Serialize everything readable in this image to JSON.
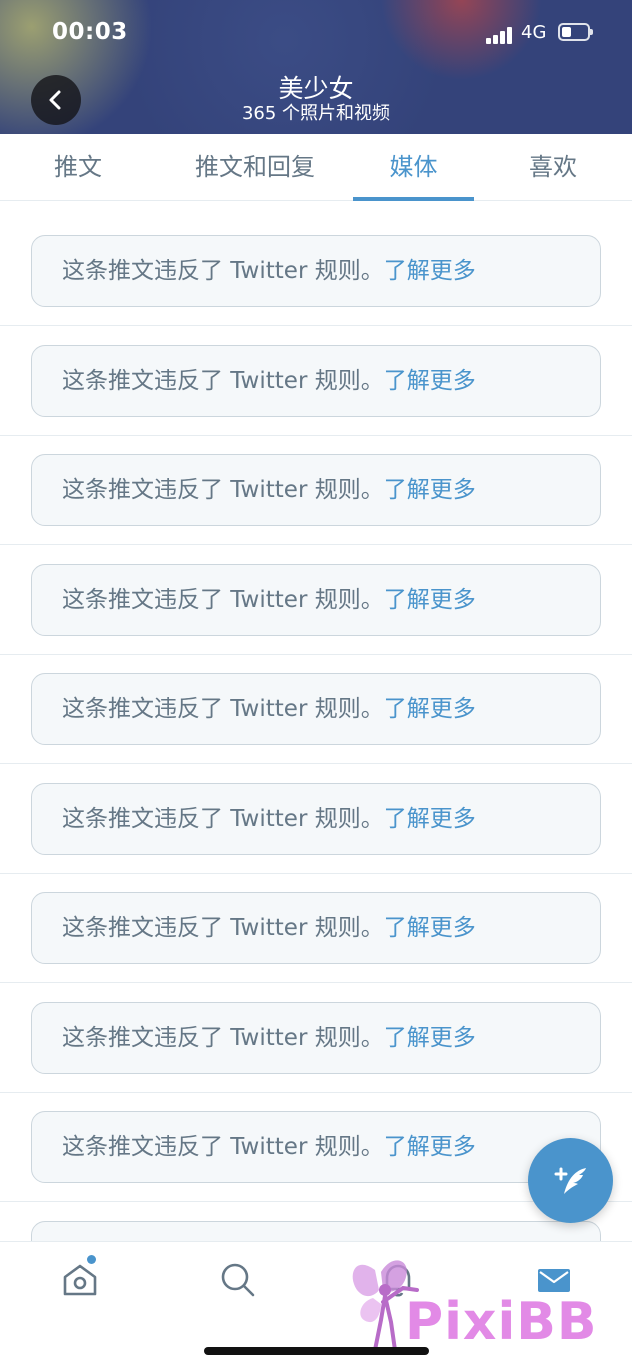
{
  "status_bar": {
    "time": "00:03",
    "network": "4G"
  },
  "header": {
    "title": "美少女",
    "subtitle": "365 个照片和视频"
  },
  "tabs": [
    {
      "label": "推文",
      "active": false
    },
    {
      "label": "推文和回复",
      "active": false
    },
    {
      "label": "媒体",
      "active": true
    },
    {
      "label": "喜欢",
      "active": false
    }
  ],
  "notice": {
    "text": "这条推文违反了 Twitter 规则。",
    "link": "了解更多"
  },
  "notice_count": 9,
  "watermark": {
    "text": "PixiBB"
  },
  "icons": {
    "back": "chevron-left-icon",
    "compose": "compose-tweet-icon",
    "home": "home-icon",
    "search": "search-icon",
    "notifications": "bell-icon",
    "messages": "mail-icon"
  },
  "colors": {
    "accent": "#4a94cc",
    "muted_text": "#657786",
    "header_bg": "#34437a"
  }
}
